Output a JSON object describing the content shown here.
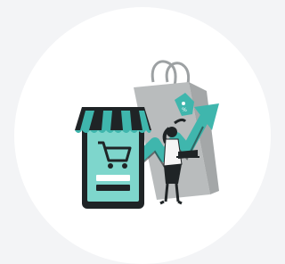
{
  "colors": {
    "background": "#f3f4f6",
    "circle": "#ffffff",
    "accent_teal": "#3fb6ad",
    "dark": "#1f2426",
    "bag_gray": "#b9bcbd"
  },
  "illustration": {
    "subject": "ecommerce-growth",
    "icons": [
      "phone-storefront-icon",
      "shopping-cart-icon",
      "shopping-bag-icon",
      "price-tag-icon",
      "trend-arrow-icon",
      "woman-with-laptop-icon"
    ]
  }
}
